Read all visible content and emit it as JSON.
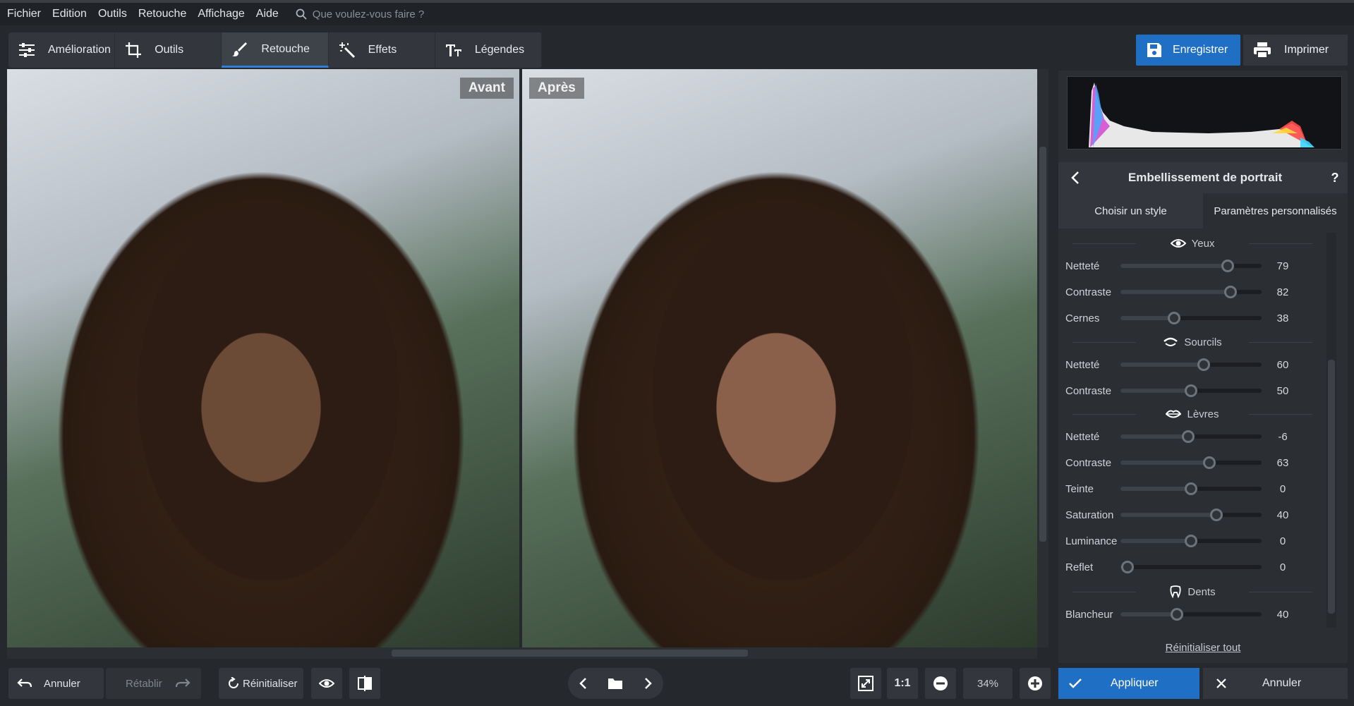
{
  "menu": {
    "items": [
      "Fichier",
      "Edition",
      "Outils",
      "Retouche",
      "Affichage",
      "Aide"
    ],
    "search_placeholder": "Que voulez-vous faire ?"
  },
  "tabs": [
    {
      "label": "Amélioration",
      "icon": "sliders-icon",
      "active": false
    },
    {
      "label": "Outils",
      "icon": "crop-icon",
      "active": false
    },
    {
      "label": "Retouche",
      "icon": "brush-icon",
      "active": true
    },
    {
      "label": "Effets",
      "icon": "magic-wand-icon",
      "active": false
    },
    {
      "label": "Légendes",
      "icon": "text-icon",
      "active": false
    }
  ],
  "actions": {
    "save": "Enregistrer",
    "print": "Imprimer"
  },
  "compare": {
    "before": "Avant",
    "after": "Après"
  },
  "panel": {
    "title": "Embellissement de portrait",
    "help": "?",
    "tabs": [
      {
        "label": "Choisir un style",
        "active": false
      },
      {
        "label": "Paramètres personnalisés",
        "active": true
      }
    ],
    "reset_all": "Réinitialiser tout"
  },
  "sections": {
    "eyes": "Yeux",
    "brows": "Sourcils",
    "lips": "Lèvres",
    "teeth": "Dents"
  },
  "sliders": {
    "eyes_sharpness": {
      "label": "Netteté",
      "value": "79",
      "fraction": 0.76
    },
    "eyes_contrast": {
      "label": "Contraste",
      "value": "82",
      "fraction": 0.78
    },
    "eyes_circles": {
      "label": "Cernes",
      "value": "38",
      "fraction": 0.38
    },
    "brows_sharpness": {
      "label": "Netteté",
      "value": "60",
      "fraction": 0.59
    },
    "brows_contrast": {
      "label": "Contraste",
      "value": "50",
      "fraction": 0.5
    },
    "lips_sharpness": {
      "label": "Netteté",
      "value": "-6",
      "fraction": 0.48
    },
    "lips_contrast": {
      "label": "Contraste",
      "value": "63",
      "fraction": 0.63
    },
    "lips_tint": {
      "label": "Teinte",
      "value": "0",
      "fraction": 0.5
    },
    "lips_saturation": {
      "label": "Saturation",
      "value": "40",
      "fraction": 0.68
    },
    "lips_luminance": {
      "label": "Luminance",
      "value": "0",
      "fraction": 0.5
    },
    "lips_shine": {
      "label": "Reflet",
      "value": "0",
      "fraction": 0.05
    },
    "teeth_whiteness": {
      "label": "Blancheur",
      "value": "40",
      "fraction": 0.4
    }
  },
  "bottom": {
    "undo": "Annuler",
    "redo": "Rétablir",
    "reset": "Réinitialiser",
    "zoom_one": "1:1",
    "zoom": "34%",
    "apply": "Appliquer",
    "cancel": "Annuler"
  },
  "colors": {
    "accent": "#1f6fc5",
    "panel": "#2b2e33",
    "background": "#25282d"
  }
}
